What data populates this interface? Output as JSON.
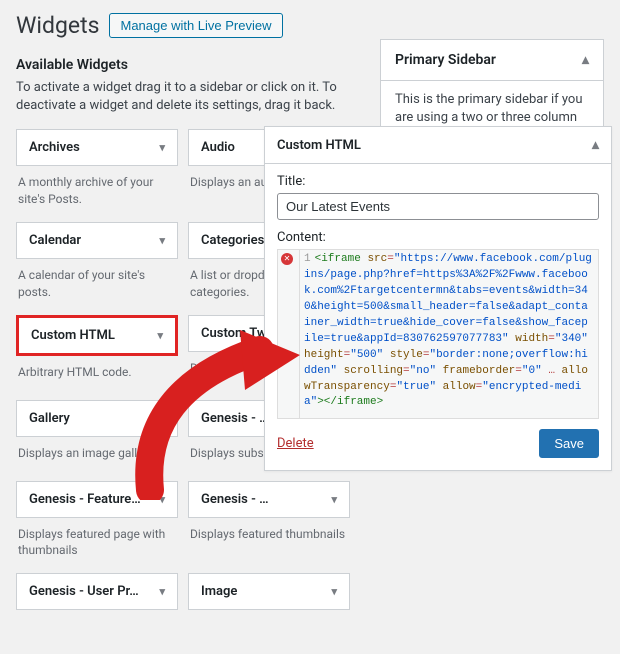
{
  "header": {
    "title": "Widgets",
    "manage_button": "Manage with Live Preview"
  },
  "available": {
    "heading": "Available Widgets",
    "help": "To activate a widget drag it to a sidebar or click on it. To deactivate a widget and delete its settings, drag it back."
  },
  "widgets": [
    {
      "title": "Archives",
      "desc": "A monthly archive of your site's Posts.",
      "hl": false
    },
    {
      "title": "Audio",
      "desc": "Displays an audio",
      "hl": false
    },
    {
      "title": "Calendar",
      "desc": "A calendar of your site's posts.",
      "hl": false
    },
    {
      "title": "Categories",
      "desc": "A list or dropdown categories.",
      "hl": false
    },
    {
      "title": "Custom HTML",
      "desc": "Arbitrary HTML code.",
      "hl": true
    },
    {
      "title": "Custom Twitter",
      "desc": "Display your Twit",
      "hl": false
    },
    {
      "title": "Gallery",
      "desc": "Displays an image gallery.",
      "hl": false
    },
    {
      "title": "Genesis - …",
      "desc": "Displays subscrit",
      "hl": false
    },
    {
      "title": "Genesis - Feature…",
      "desc": "Displays featured page with thumbnails",
      "hl": false
    },
    {
      "title": "Genesis - …",
      "desc": "Displays featured thumbnails",
      "hl": false
    },
    {
      "title": "Genesis - User Pr…",
      "desc": "",
      "hl": false
    },
    {
      "title": "Image",
      "desc": "",
      "hl": false
    }
  ],
  "sidebar": {
    "title": "Primary Sidebar",
    "desc": "This is the primary sidebar if you are using a two or three column site layout option."
  },
  "editor": {
    "panel_title": "Custom HTML",
    "title_label": "Title:",
    "title_value": "Our Latest Events",
    "content_label": "Content:",
    "line_number": "1",
    "delete": "Delete",
    "save": "Save",
    "code": {
      "open_tag": "<iframe",
      "a_src": "src",
      "v_src": "\"https://www.facebook.com/plugins/page.php?href=https%3A%2F%2Fwww.facebook.com%2Ftargetcentermn&tabs=events&width=340&height=500&small_header=false&adapt_container_width=true&hide_cover=false&show_facepile=true&appId=830762597077783\"",
      "a_w": "width",
      "v_w": "\"340\"",
      "a_h": "height",
      "v_h": "\"500\"",
      "a_style": "style",
      "v_style": "\"border:none;overflow:hidden\"",
      "a_scroll": "scrolling",
      "v_scroll": "\"no\"",
      "a_fb": "frameborder",
      "v_fb": "\"0\"",
      "a_at": "allowTransparency",
      "v_at": "\"true\"",
      "a_allow": "allow",
      "v_allow": "\"encrypted-media\"",
      "close": "></iframe>"
    }
  }
}
